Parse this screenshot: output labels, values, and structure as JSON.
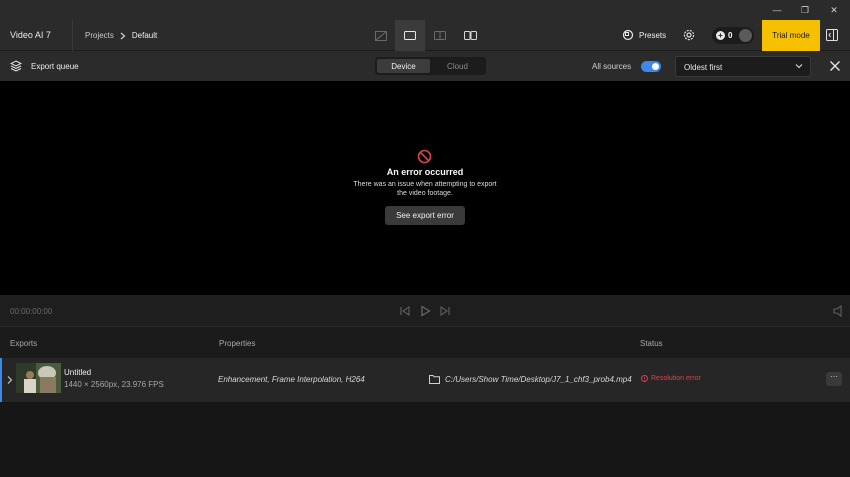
{
  "window": {
    "minimize_glyph": "—",
    "restore_glyph": "❐",
    "close_glyph": "✕"
  },
  "topbar": {
    "app_title": "Video AI  7",
    "breadcrumb": {
      "parent": "Projects",
      "current": "Default"
    },
    "presets_label": "Presets",
    "credits_count": "0",
    "trial_label": "Trial mode"
  },
  "queuebar": {
    "title": "Export queue",
    "segments": [
      {
        "label": "Device"
      },
      {
        "label": "Cloud"
      }
    ],
    "all_sources_label": "All sources",
    "all_sources_on": true,
    "sort_value": "Oldest first"
  },
  "preview": {
    "error_title": "An error occurred",
    "error_message": "There was an issue when attempting to export the video footage.",
    "error_button": "See export error"
  },
  "transport": {
    "timecode": "00:00:00:00"
  },
  "table": {
    "headers": {
      "exports": "Exports",
      "properties": "Properties",
      "status": "Status"
    },
    "rows": [
      {
        "name": "Untitled",
        "meta": "1440 × 2560px, 23.976 FPS",
        "properties": "Enhancement, Frame Interpolation, H264",
        "path": "C:/Users/Show Time/Desktop/J7_1_chf3_prob4.mp4",
        "status": "Resolution error",
        "more_label": "···"
      }
    ]
  },
  "colors": {
    "accent": "#3d88e8",
    "trial": "#f5c000",
    "error": "#e0404a",
    "background": "#161616"
  }
}
